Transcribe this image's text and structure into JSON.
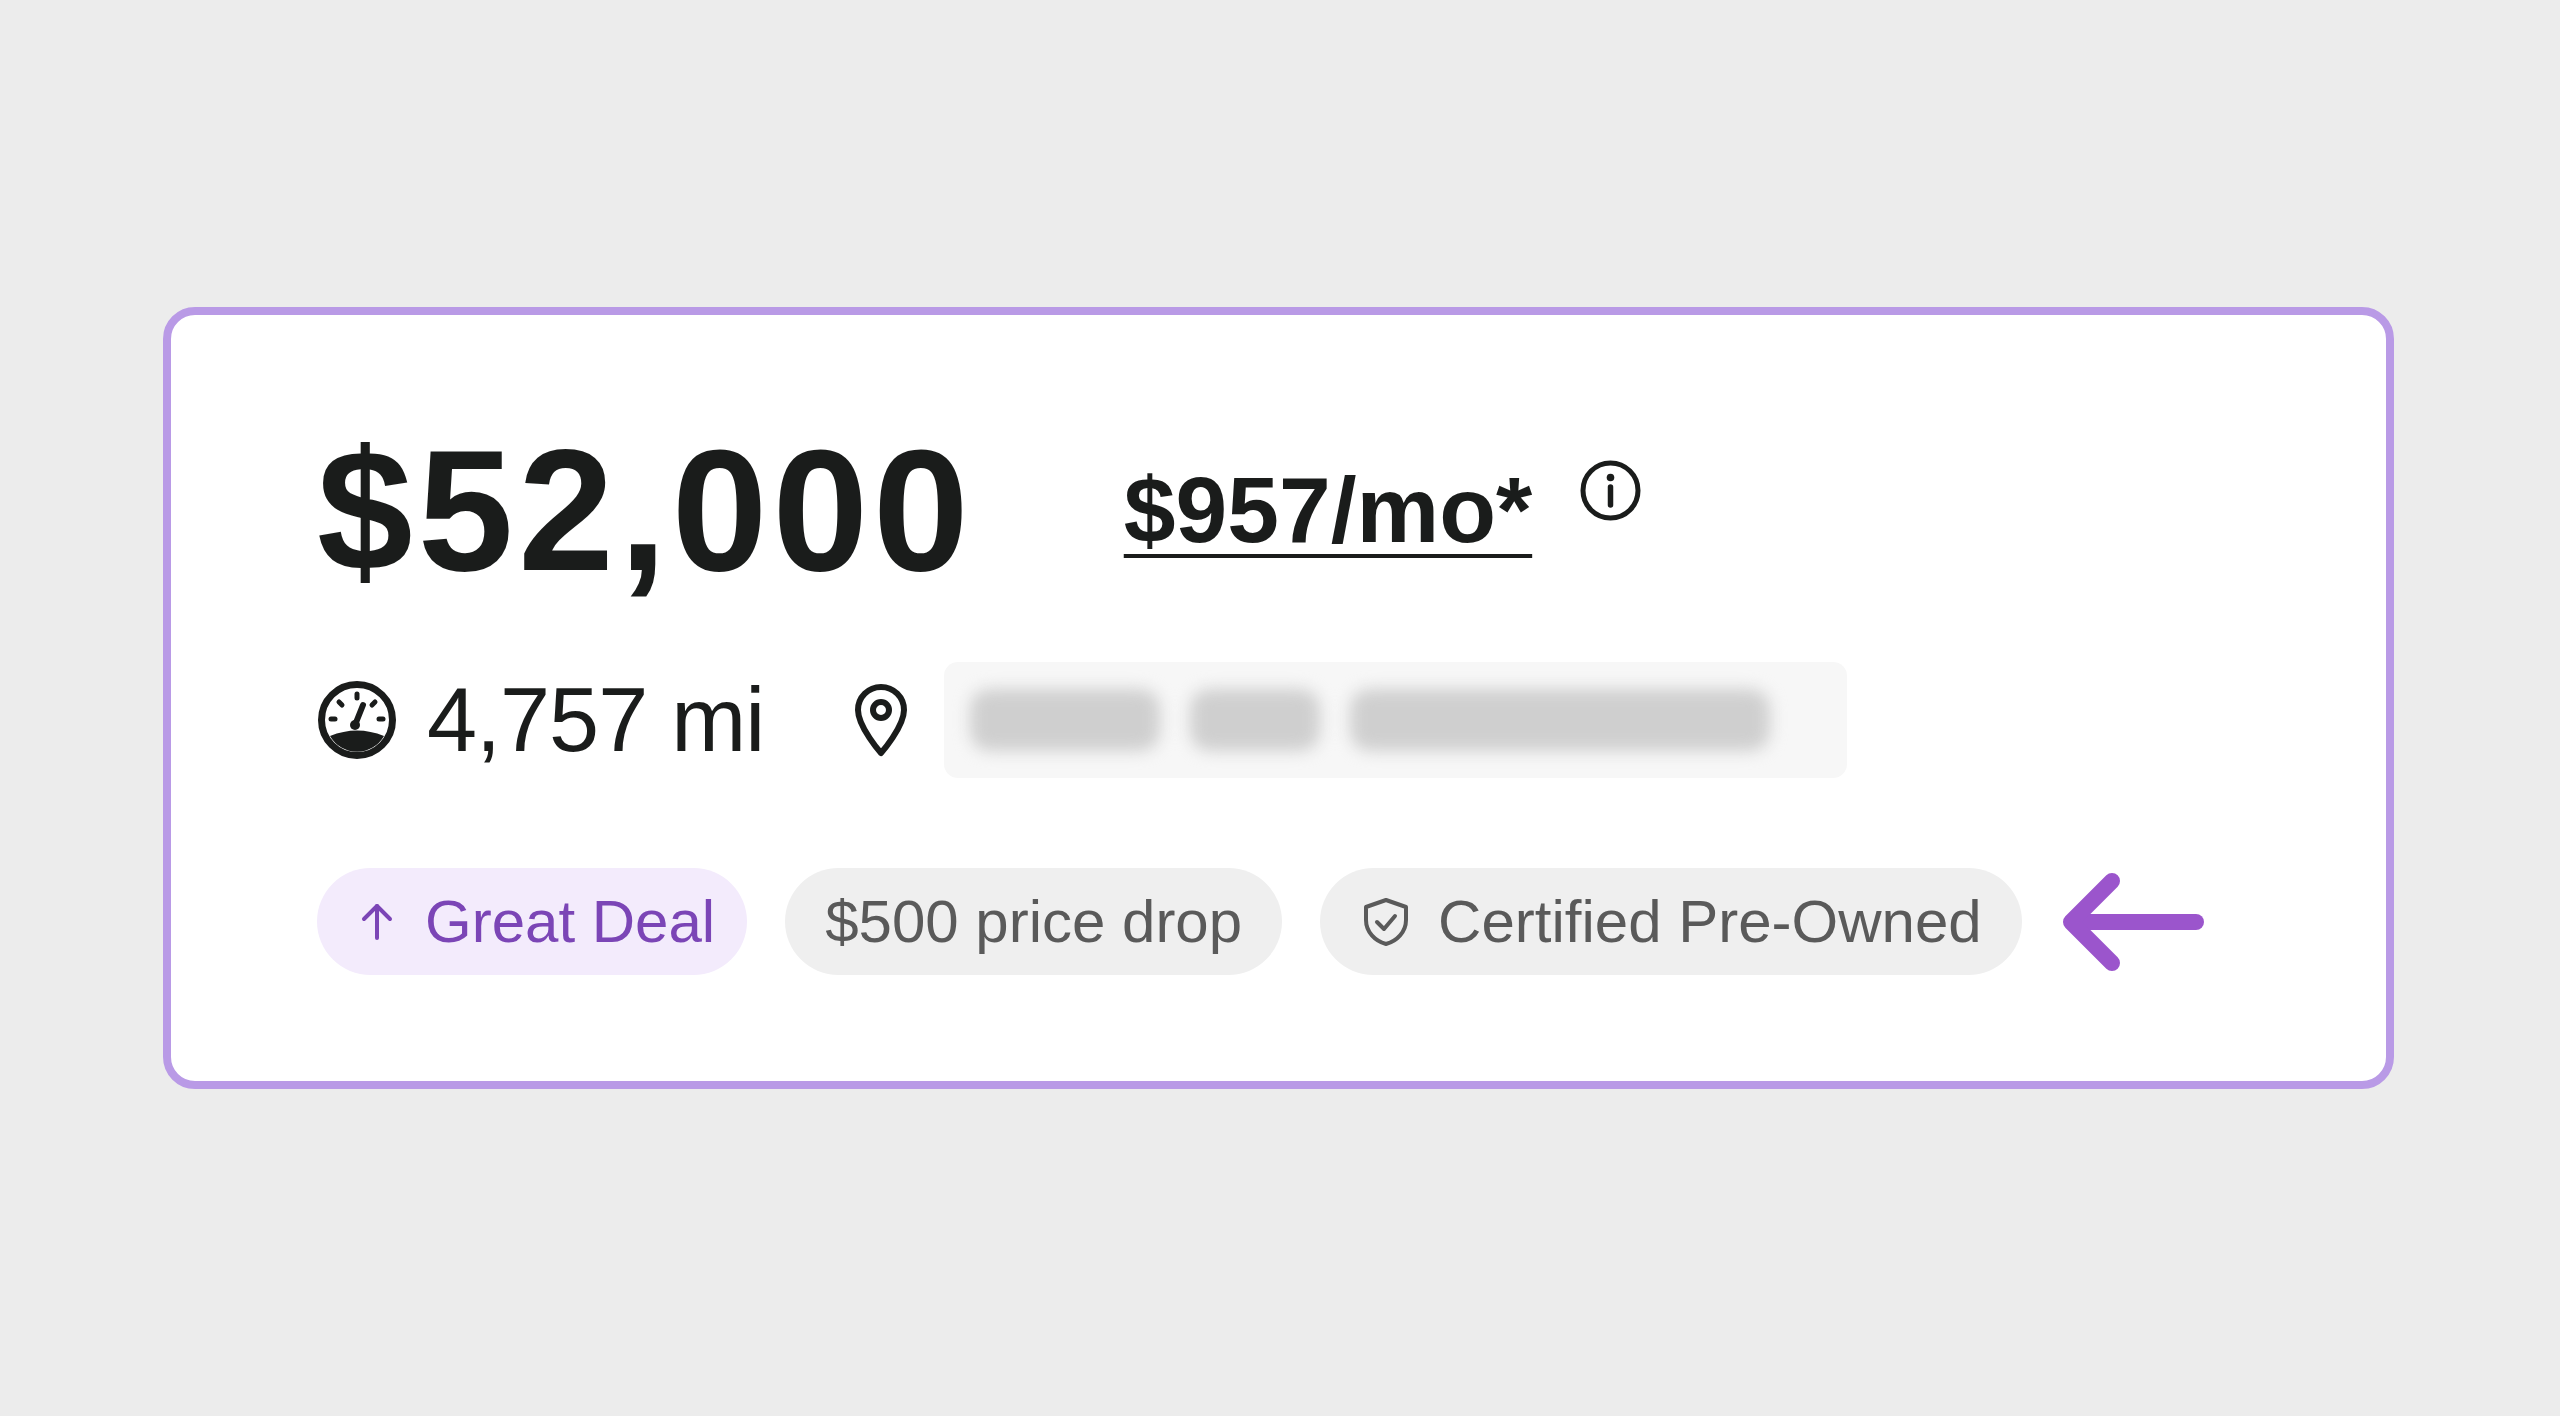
{
  "listing": {
    "price": "$52,000",
    "monthly_payment": "$957/mo*",
    "mileage": "4,757 mi",
    "location": {
      "redacted": true
    },
    "badges": [
      {
        "kind": "deal",
        "label": "Great Deal"
      },
      {
        "kind": "plain",
        "label": "$500 price drop"
      },
      {
        "kind": "certified",
        "label": "Certified Pre-Owned"
      }
    ]
  }
}
